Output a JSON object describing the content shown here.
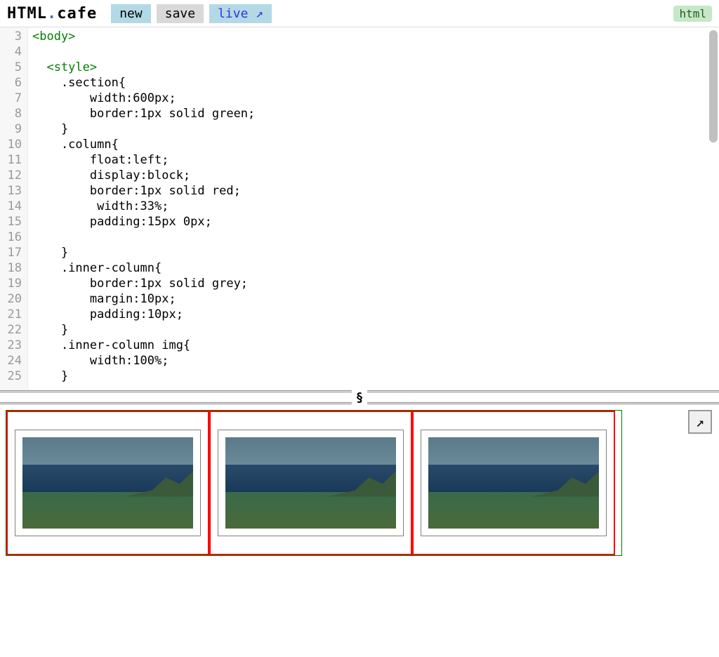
{
  "header": {
    "logo_html": "HTML",
    "logo_dot": ".",
    "logo_cafe": "cafe",
    "new_label": "new",
    "save_label": "save",
    "live_label": "live",
    "live_arrow": "↗",
    "html_label": "html"
  },
  "editor": {
    "line_numbers": [
      3,
      4,
      5,
      6,
      7,
      8,
      9,
      10,
      11,
      12,
      13,
      14,
      15,
      16,
      17,
      18,
      19,
      20,
      21,
      22,
      23,
      24,
      25
    ],
    "code_lines": [
      {
        "indent": 0,
        "type": "tag",
        "content": "<body>"
      },
      {
        "indent": 0,
        "type": "blank",
        "content": ""
      },
      {
        "indent": 2,
        "type": "tag",
        "content": "<style>"
      },
      {
        "indent": 4,
        "type": "text",
        "content": ".section{"
      },
      {
        "indent": 8,
        "type": "text",
        "content": "width:600px;"
      },
      {
        "indent": 8,
        "type": "text",
        "content": "border:1px solid green;"
      },
      {
        "indent": 4,
        "type": "text",
        "content": "}"
      },
      {
        "indent": 4,
        "type": "text",
        "content": ".column{"
      },
      {
        "indent": 8,
        "type": "text",
        "content": "float:left;"
      },
      {
        "indent": 8,
        "type": "text",
        "content": "display:block;"
      },
      {
        "indent": 8,
        "type": "text",
        "content": "border:1px solid red;"
      },
      {
        "indent": 9,
        "type": "text",
        "content": "width:33%;"
      },
      {
        "indent": 8,
        "type": "text",
        "content": "padding:15px 0px;"
      },
      {
        "indent": 0,
        "type": "blank",
        "content": ""
      },
      {
        "indent": 4,
        "type": "text",
        "content": "}"
      },
      {
        "indent": 4,
        "type": "text",
        "content": ".inner-column{"
      },
      {
        "indent": 8,
        "type": "text",
        "content": "border:1px solid grey;"
      },
      {
        "indent": 8,
        "type": "text",
        "content": "margin:10px;"
      },
      {
        "indent": 8,
        "type": "text",
        "content": "padding:10px;"
      },
      {
        "indent": 4,
        "type": "text",
        "content": "}"
      },
      {
        "indent": 4,
        "type": "text",
        "content": ".inner-column img{"
      },
      {
        "indent": 8,
        "type": "text",
        "content": "width:100%;"
      },
      {
        "indent": 4,
        "type": "text",
        "content": "}"
      }
    ]
  },
  "divider": {
    "icon": "§"
  },
  "popout": {
    "icon": "↗"
  }
}
